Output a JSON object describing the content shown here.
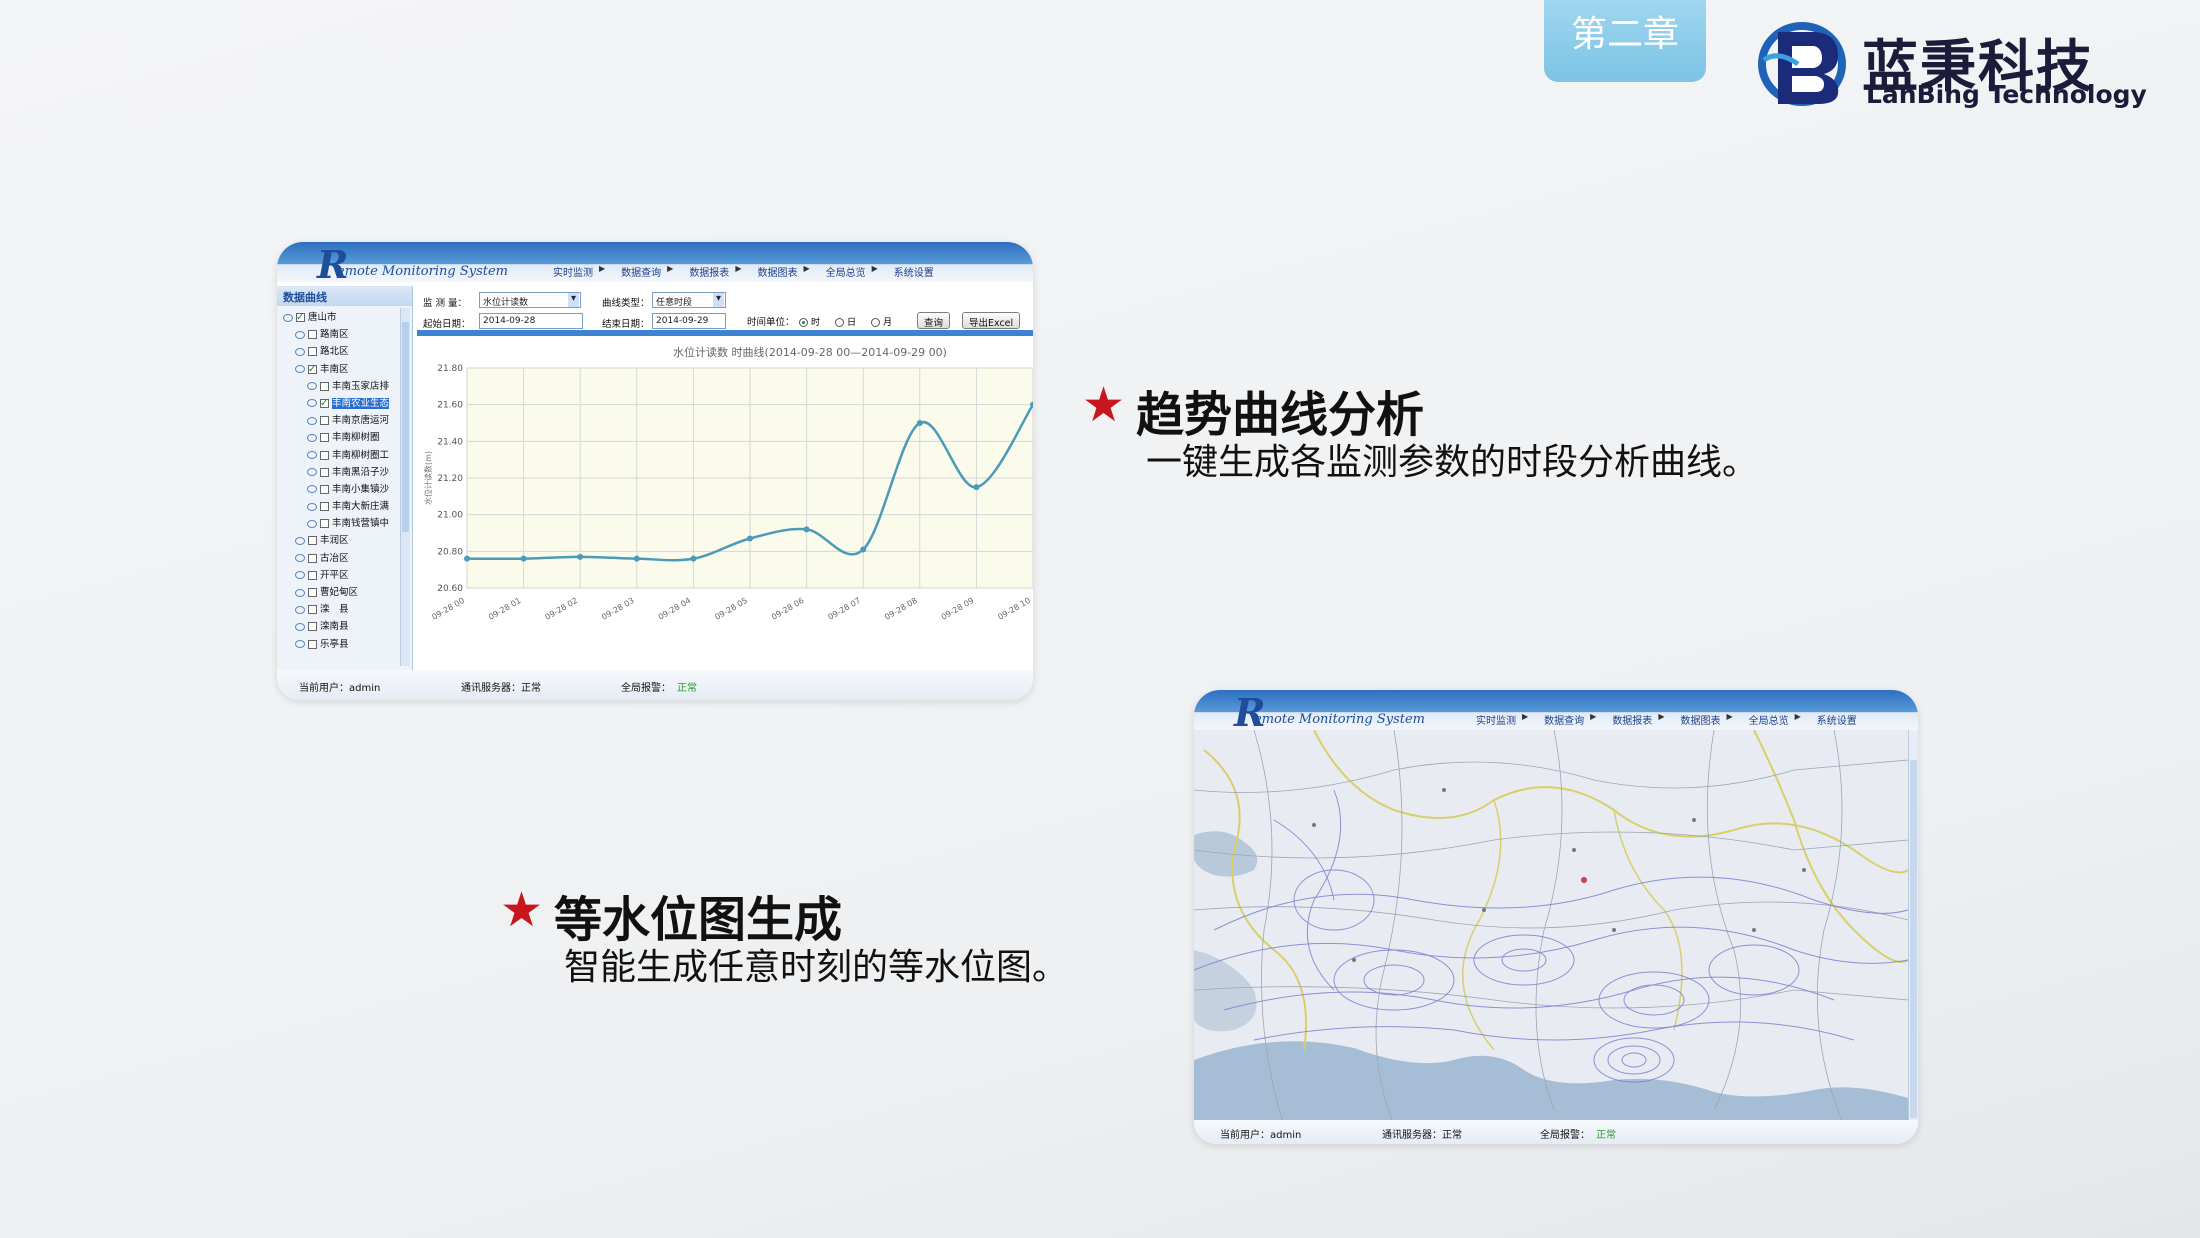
{
  "chapter": "第二章",
  "logo": {
    "cn": "蓝秉科技",
    "en": "LanBing Technology"
  },
  "features": [
    {
      "title": "趋势曲线分析",
      "desc": "一键生成各监测参数的时段分析曲线。"
    },
    {
      "title": "等水位图生成",
      "desc": "智能生成任意时刻的等水位图。"
    }
  ],
  "app": {
    "system_name": "emote Monitoring System",
    "logo_letter": "R",
    "nav": [
      "实时监测",
      "数据查询",
      "数据报表",
      "数据图表",
      "全局总览",
      "系统设置"
    ],
    "status": {
      "user": "当前用户：admin",
      "server": "通讯服务器：正常",
      "alarm_label": "全局报警：",
      "alarm_value": "正常"
    }
  },
  "curve_screen": {
    "panel_title": "数据曲线",
    "tree": [
      {
        "label": "唐山市",
        "level": 0,
        "checked": true
      },
      {
        "label": "路南区",
        "level": 1,
        "checked": false
      },
      {
        "label": "路北区",
        "level": 1,
        "checked": false
      },
      {
        "label": "丰南区",
        "level": 1,
        "checked": true
      },
      {
        "label": "丰南玉家店排",
        "level": 2,
        "checked": false
      },
      {
        "label": "丰南农业生态",
        "level": 2,
        "checked": true,
        "selected": true
      },
      {
        "label": "丰南京唐运河",
        "level": 2,
        "checked": false
      },
      {
        "label": "丰南柳树圈",
        "level": 2,
        "checked": false
      },
      {
        "label": "丰南柳树圈工",
        "level": 2,
        "checked": false
      },
      {
        "label": "丰南黑沿子沙",
        "level": 2,
        "checked": false
      },
      {
        "label": "丰南小集镇沙",
        "level": 2,
        "checked": false
      },
      {
        "label": "丰南大新庄满",
        "level": 2,
        "checked": false
      },
      {
        "label": "丰南钱营镇中",
        "level": 2,
        "checked": false
      },
      {
        "label": "丰润区",
        "level": 1,
        "checked": false
      },
      {
        "label": "古冶区",
        "level": 1,
        "checked": false
      },
      {
        "label": "开平区",
        "level": 1,
        "checked": false
      },
      {
        "label": "曹妃甸区",
        "level": 1,
        "checked": false
      },
      {
        "label": "滦　县",
        "level": 1,
        "checked": false
      },
      {
        "label": "滦南县",
        "level": 1,
        "checked": false
      },
      {
        "label": "乐亭县",
        "level": 1,
        "checked": false
      }
    ],
    "query": {
      "measure_label": "监 测 量：",
      "measure_value": "水位计读数",
      "curve_type_label": "曲线类型：",
      "curve_type_value": "任意时段",
      "start_label": "起始日期：",
      "start_value": "2014-09-28",
      "end_label": "结束日期：",
      "end_value": "2014-09-29",
      "unit_label": "时间单位：",
      "units": [
        "时",
        "日",
        "月"
      ],
      "unit_selected": 0,
      "query_btn": "查询",
      "export_btn": "导出Excel"
    }
  },
  "chart_data": {
    "type": "line",
    "title": "水位计读数  时曲线(2014-09-28 00—2014-09-29 00)",
    "ylabel": "水位计读数(m)",
    "xlabel": "",
    "x": [
      "09-28 00",
      "09-28 01",
      "09-28 02",
      "09-28 03",
      "09-28 04",
      "09-28 05",
      "09-28 06",
      "09-28 07",
      "09-28 08",
      "09-28 09",
      "09-28 10"
    ],
    "values": [
      20.76,
      20.76,
      20.77,
      20.76,
      20.76,
      20.87,
      20.92,
      20.81,
      21.5,
      21.15,
      21.6
    ],
    "ylim": [
      20.6,
      21.8
    ],
    "yticks": [
      "20.60",
      "20.80",
      "21.00",
      "21.20",
      "21.40",
      "21.60",
      "21.80"
    ],
    "grid": true,
    "color": "#4a9ab8"
  }
}
